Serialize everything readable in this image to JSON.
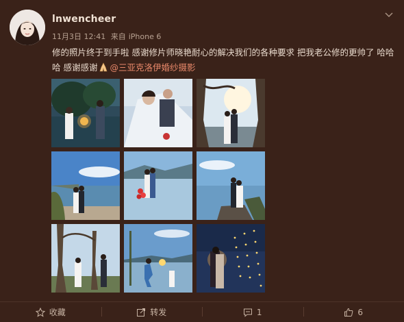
{
  "post": {
    "username": "lnwencheer",
    "date": "11月3日 12:41",
    "source_prefix": "来自",
    "source": "iPhone 6",
    "text_main": "修的照片终于到手啦 感谢修片师晓艳耐心的解决我们的各种要求 把我老公修的更帅了 哈哈哈 感谢感谢",
    "emoji": "praying-hands",
    "mention": "@三亚克洛伊婚纱摄影",
    "photo_count": 9
  },
  "toolbar": {
    "favorite_label": "收藏",
    "repost_label": "转发",
    "comment_count": "1",
    "like_count": "6"
  },
  "colors": {
    "background": "#3a2219",
    "text": "#e9dacd",
    "mention": "#e8886a",
    "meta": "#b8a292"
  }
}
